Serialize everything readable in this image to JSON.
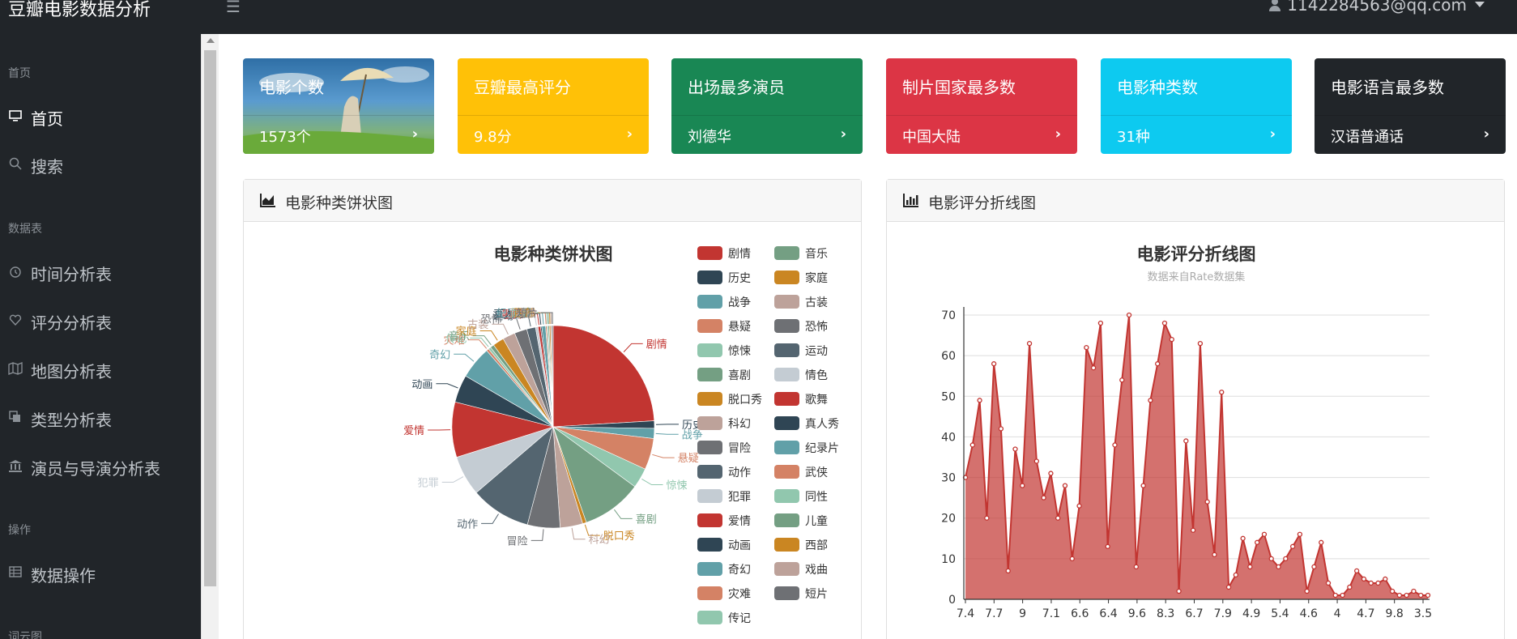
{
  "app": {
    "title": "豆瓣电影数据分析",
    "user": "1142284563@qq.com"
  },
  "sidebar": {
    "sections": [
      {
        "heading": "首页",
        "items": [
          {
            "label": "首页",
            "icon": "monitor-icon",
            "active": true
          },
          {
            "label": "搜索",
            "icon": "search-icon",
            "active": false
          }
        ]
      },
      {
        "heading": "数据表",
        "items": [
          {
            "label": "时间分析表",
            "icon": "clock-icon"
          },
          {
            "label": "评分分析表",
            "icon": "heart-icon"
          },
          {
            "label": "地图分析表",
            "icon": "map-icon"
          },
          {
            "label": "类型分析表",
            "icon": "copy-icon"
          },
          {
            "label": "演员与导演分析表",
            "icon": "bank-icon"
          }
        ]
      },
      {
        "heading": "操作",
        "items": [
          {
            "label": "数据操作",
            "icon": "table-icon"
          }
        ]
      },
      {
        "heading": "词云图",
        "items": []
      }
    ]
  },
  "cards": [
    {
      "title": "电影个数",
      "value": "1573个",
      "color": "#3a7fb8"
    },
    {
      "title": "豆瓣最高评分",
      "value": "9.8分",
      "color": "#ffc107"
    },
    {
      "title": "出场最多演员",
      "value": "刘德华",
      "color": "#198754"
    },
    {
      "title": "制片国家最多数",
      "value": "中国大陆",
      "color": "#dc3545"
    },
    {
      "title": "电影种类数",
      "value": "31种",
      "color": "#0dcaf0"
    },
    {
      "title": "电影语言最多数",
      "value": "汉语普通话",
      "color": "#212529"
    }
  ],
  "panels": {
    "pie_header": "电影种类饼状图",
    "line_header": "电影评分折线图"
  },
  "chart_data": [
    {
      "type": "pie",
      "title": "电影种类饼状图",
      "legend_position": "right",
      "categories": [
        "剧情",
        "历史",
        "战争",
        "悬疑",
        "惊悚",
        "喜剧",
        "脱口秀",
        "科幻",
        "冒险",
        "动作",
        "犯罪",
        "爱情",
        "动画",
        "奇幻",
        "灾难",
        "传记",
        "音乐",
        "家庭",
        "古装",
        "恐怖",
        "运动",
        "情色",
        "歌舞",
        "真人秀",
        "纪录片",
        "武侠",
        "同性",
        "儿童",
        "西部",
        "戏曲",
        "短片"
      ],
      "values": [
        120,
        6,
        8,
        25,
        16,
        48,
        3,
        18,
        26,
        48,
        32,
        44,
        22,
        26,
        2,
        2,
        3,
        9,
        10,
        10,
        7,
        2,
        2,
        1,
        3,
        1,
        1,
        1,
        1,
        1,
        1
      ],
      "colors": [
        "#c23531",
        "#2f4554",
        "#61a0a8",
        "#d48265",
        "#91c7ae",
        "#749f83",
        "#ca8622",
        "#bda29a",
        "#6e7074",
        "#546570",
        "#c4ccd3",
        "#c23531",
        "#2f4554",
        "#61a0a8",
        "#d48265",
        "#91c7ae",
        "#749f83",
        "#ca8622",
        "#bda29a",
        "#6e7074",
        "#546570",
        "#c4ccd3",
        "#c23531",
        "#2f4554",
        "#61a0a8",
        "#d48265",
        "#91c7ae",
        "#749f83",
        "#ca8622",
        "#bda29a",
        "#6e7074"
      ]
    },
    {
      "type": "area",
      "title": "电影评分折线图",
      "subtitle": "数据来自Rate数据集",
      "ylim": [
        0,
        70
      ],
      "yticks": [
        0,
        10,
        20,
        30,
        40,
        50,
        60,
        70
      ],
      "xticks": [
        "7.4",
        "7.7",
        "9",
        "7.1",
        "6.6",
        "6.4",
        "9.6",
        "8.3",
        "6.7",
        "7.9",
        "4.9",
        "5.4",
        "4.6",
        "4",
        "4.7",
        "9.8",
        "3.5"
      ],
      "color": "#c23531",
      "values": [
        30,
        38,
        49,
        20,
        58,
        42,
        7,
        37,
        28,
        63,
        34,
        25,
        31,
        20,
        28,
        10,
        23,
        62,
        57,
        68,
        13,
        38,
        54,
        70,
        8,
        28,
        49,
        58,
        68,
        64,
        2,
        39,
        17,
        63,
        24,
        11,
        51,
        3,
        6,
        15,
        8,
        14,
        16,
        10,
        8,
        10,
        13,
        16,
        2,
        8,
        14,
        4,
        1,
        1,
        3,
        7,
        5,
        4,
        4,
        5,
        2,
        1,
        1,
        2,
        1,
        1
      ]
    }
  ]
}
